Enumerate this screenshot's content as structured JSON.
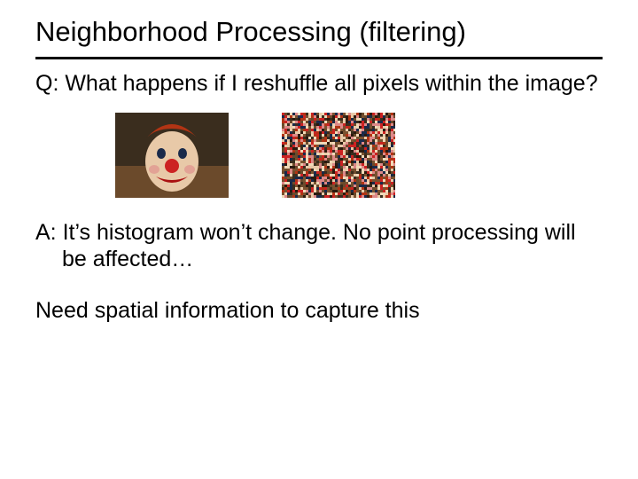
{
  "slide": {
    "title": "Neighborhood Processing (filtering)",
    "question": "Q: What happens if I reshuffle all pixels within the image?",
    "answer": "A: It’s histogram won’t change.  No point processing will be affected…",
    "note": "Need spatial information to capture this",
    "images": {
      "original_alt": "clown-original",
      "shuffled_alt": "clown-shuffled"
    }
  }
}
